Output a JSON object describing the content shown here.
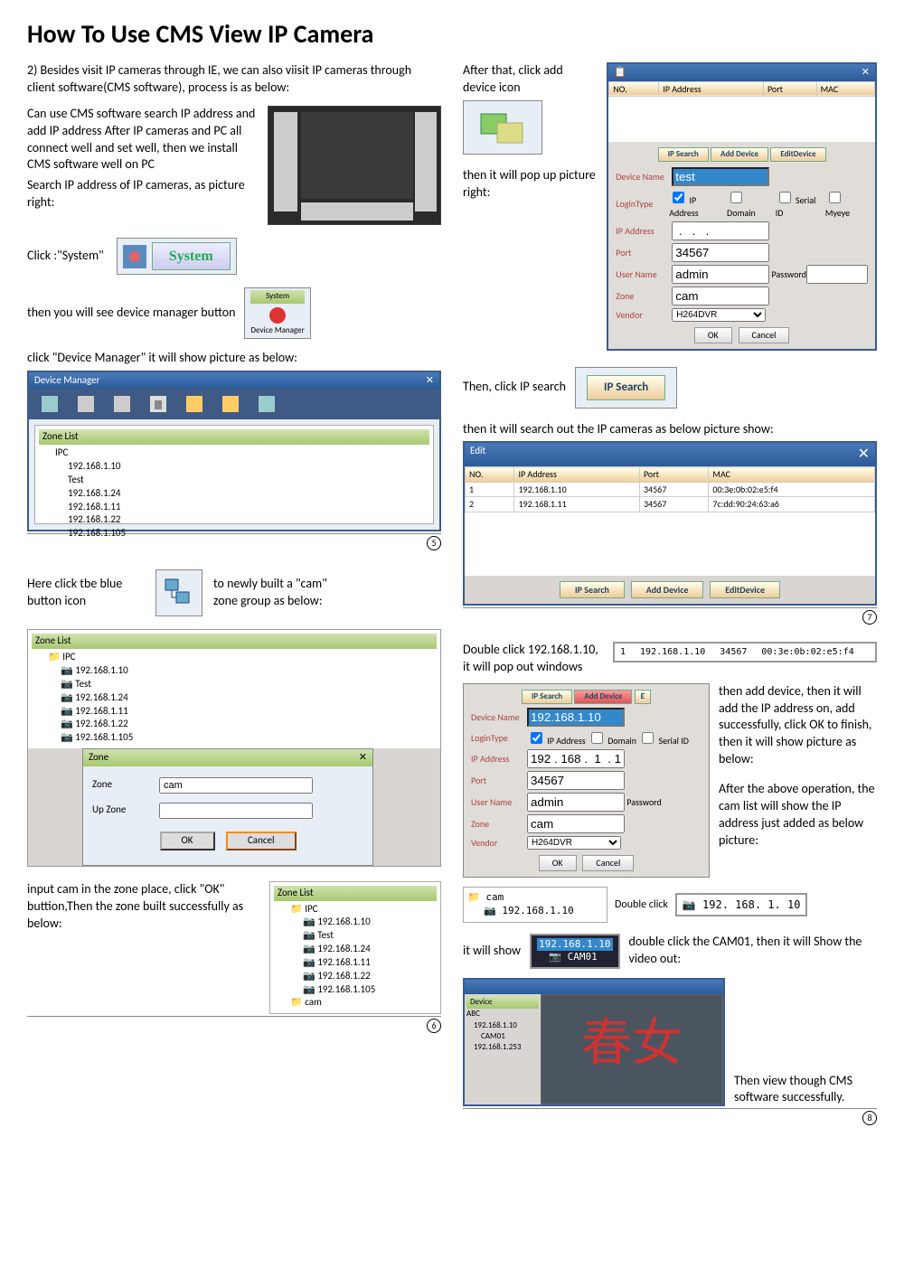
{
  "title": "How To Use CMS View IP Camera",
  "intro": "2) Besides visit IP cameras through IE, we can also viisit IP cameras through client software(CMS software), process is as below:",
  "step1": "Can use CMS software search IP address and add IP address After IP cameras and PC all connect well and set well, then we install CMS software well on PC",
  "step2": "Search IP address of IP cameras, as picture right:",
  "click_system": "Click :\"System\"",
  "system_label": "System",
  "then_devmgr": "then you will see device manager button",
  "devmgr_label": "Device Manager",
  "click_devmgr": "click \"Device Manager\" it will show picture as below:",
  "devmgr_title": "Device Manager",
  "zone_list": "Zone List",
  "ipc": "IPC",
  "ips": [
    "192.168.1.10",
    "Test",
    "192.168.1.24",
    "192.168.1.11",
    "192.168.1.22",
    "192.168.1.105"
  ],
  "circled_5": "5",
  "here_click": "Here click tbe blue button icon",
  "to_newly": "to newly built a \"cam\" zone group as below:",
  "zone_dlg_title": "Zone",
  "zone_field": "Zone",
  "upzone_field": "Up Zone",
  "zone_value": "cam",
  "ok": "OK",
  "cancel": "Cancel",
  "input_cam": "input cam in the zone place, click \"OK\" buttion,Then the zone built successfully as below:",
  "cam_label": "cam",
  "circled_6": "6",
  "after_click_add": "After that, click add device icon",
  "pop_up": "then it will pop up picture right:",
  "add_dlg": {
    "cols": [
      "NO.",
      "IP Address",
      "Port",
      "MAC"
    ],
    "ip_search": "IP Search",
    "add_device": "Add Device",
    "edit_device": "EditDevice",
    "device_name": "Device Name",
    "device_name_val": "test",
    "login_type": "LoginType",
    "opt_ip": "IP Address",
    "opt_domain": "Domain",
    "opt_serial": "Serial ID",
    "opt_myeye": "Myeye",
    "ip_address": "IP Address",
    "ip_val": " .   .   .   ",
    "port": "Port",
    "port_val": "34567",
    "user": "User Name",
    "user_val": "admin",
    "password": "Password",
    "zone": "Zone",
    "zone_val": "cam",
    "vendor": "Vendor",
    "vendor_val": "H264DVR"
  },
  "then_ip_search": "Then, click IP search",
  "ip_search_label": "IP Search",
  "then_search_out": "then it will search out the IP cameras as below picture show:",
  "edit_title": "Edit",
  "search_rows": [
    {
      "no": "1",
      "ip": "192.168.1.10",
      "port": "34567",
      "mac": "00:3e:0b:02:e5:f4"
    },
    {
      "no": "2",
      "ip": "192.168.1.11",
      "port": "34567",
      "mac": "7c:dd:90:24:63:a6"
    }
  ],
  "circled_7": "7",
  "double_click_ip": "Double click 192.168.1.10, it will pop out windows",
  "selected_row": {
    "no": "1",
    "ip": "192.168.1.10",
    "port": "34567",
    "mac": "00:3e:0b:02:e5:f4"
  },
  "add_dlg2": {
    "device_name_val": "192.168.1.10",
    "ip_val": "192 . 168 .  1  . 10",
    "port_val": "34567",
    "user_val": "admin",
    "zone_val": "cam",
    "vendor_val": "H264DVR"
  },
  "then_add_text": "then add device, then it will add the IP address on, add successfully, click OK to finish, then it will show picture as below:",
  "after_above": "After the above operation, the cam list will show the IP address just added as below picture:",
  "cam_box_title": "cam",
  "cam_box_ip": "192.168.1.10",
  "double_click_label": "Double click",
  "result_ip": "192. 168. 1. 10",
  "it_will_show": "it will show",
  "cam01_ip": "192.168.1.10",
  "cam01": "CAM01",
  "double_click_cam01": "double click the CAM01, then it will Show the video out:",
  "device_tree": {
    "title": "Device",
    "root": "ABC",
    "items": [
      "192.168.1.10",
      "CAM01",
      "192.168.1.253"
    ]
  },
  "final_text": "Then view though CMS software successfully.",
  "circled_8": "8"
}
